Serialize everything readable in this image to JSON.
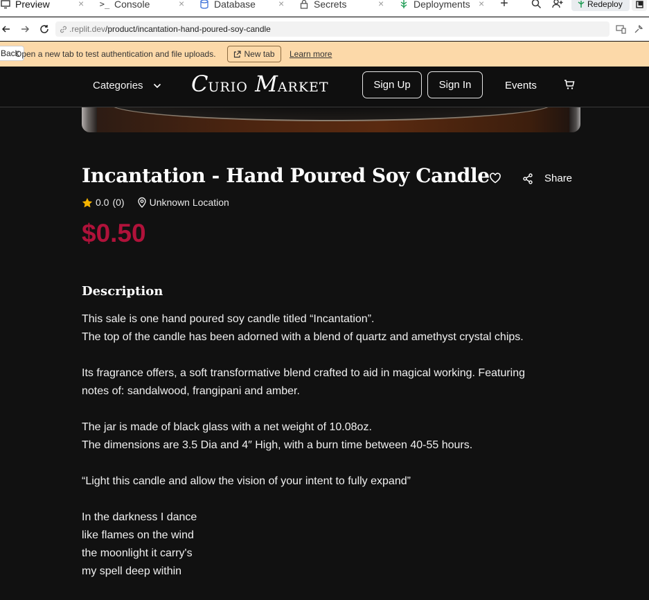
{
  "tabs": [
    {
      "label": "Preview"
    },
    {
      "label": "Console"
    },
    {
      "label": "Database"
    },
    {
      "label": "Secrets"
    },
    {
      "label": "Deployments"
    }
  ],
  "toolbar": {
    "redeploy_label": "Redeploy"
  },
  "address": {
    "host": ".replit.dev",
    "path": "/product/incantation-hand-poured-soy-candle"
  },
  "banner": {
    "back_label": "Back",
    "text": "Open a new tab to test authentication and file uploads.",
    "newtab_label": "New tab",
    "learn_more": "Learn more"
  },
  "header": {
    "categories": "Categories",
    "logo_c": "C",
    "logo_urio": "URIO",
    "logo_m": "M",
    "logo_arket": "ARKET",
    "signup": "Sign Up",
    "signin": "Sign In",
    "events": "Events"
  },
  "product": {
    "title": "Incantation - Hand Poured Soy Candle",
    "share_label": "Share",
    "rating": "0.0",
    "review_count": "(0)",
    "location": "Unknown Location",
    "price": "$0.50",
    "description_heading": "Description",
    "description_lines": [
      "This sale is one hand poured soy candle titled “Incantation”.",
      "The top of the candle has been adorned with a blend of quartz and amethyst crystal chips.",
      "",
      "Its fragrance offers, a soft transformative blend crafted to aid in magical working. Featuring",
      "notes of: sandalwood, frangipani and amber.",
      "",
      "The jar is made of black glass with a net weight of 10.08oz.",
      "The dimensions are 3.5 Dia and 4″ High, with a burn time between 40-55 hours.",
      "",
      "“Light this candle and allow the vision of your intent to fully expand”",
      "",
      "In the darkness I dance",
      "like flames on the wind",
      "the moonlight it carry's",
      "my spell deep within"
    ]
  },
  "colors": {
    "price": "#b0123a",
    "banner": "#fcd9a9",
    "page_bg": "#111111",
    "star": "#f5b400"
  }
}
